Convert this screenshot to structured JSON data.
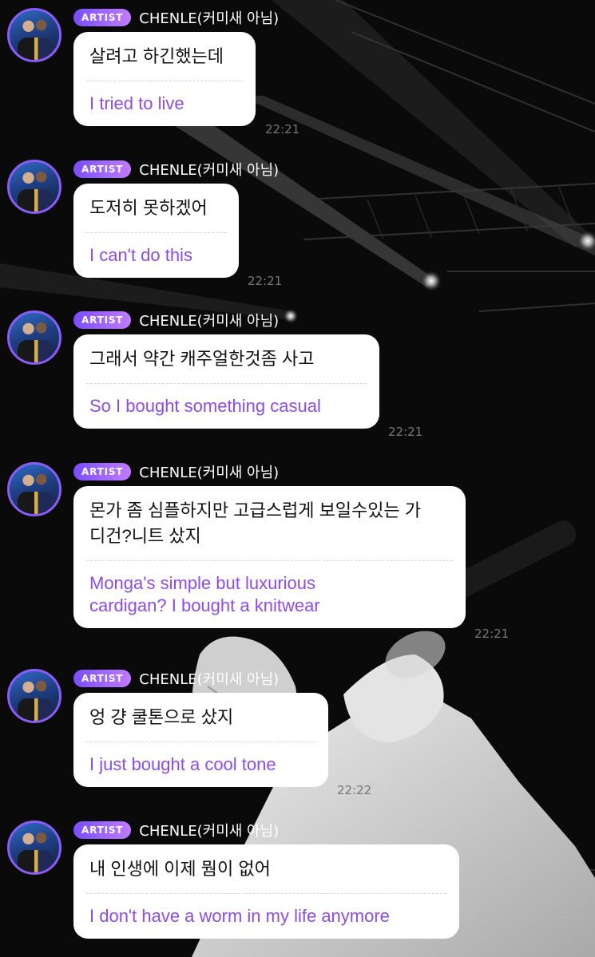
{
  "messages": [
    {
      "badge": "ARTIST",
      "name": "CHENLE(커미새 아님)",
      "original": "살려고 하긴했는데",
      "translation": "I tried to live",
      "time": "22:21"
    },
    {
      "badge": "ARTIST",
      "name": "CHENLE(커미새 아님)",
      "original": "도저히 못하겠어",
      "translation": "I can't do this",
      "time": "22:21"
    },
    {
      "badge": "ARTIST",
      "name": "CHENLE(커미새 아님)",
      "original": "그래서 약간 캐주얼한것좀 사고",
      "translation": "So I bought something casual",
      "time": "22:21"
    },
    {
      "badge": "ARTIST",
      "name": "CHENLE(커미새 아님)",
      "original": "몬가 좀 심플하지만 고급스럽게 보일수있는 가\n디건?니트 샀지",
      "translation": "Monga's simple but luxurious\ncardigan? I bought a knitwear",
      "time": "22:21"
    },
    {
      "badge": "ARTIST",
      "name": "CHENLE(커미새 아님)",
      "original": "엉 걍 쿨톤으로 샀지",
      "translation": "I just bought a cool tone",
      "time": "22:22"
    },
    {
      "badge": "ARTIST",
      "name": "CHENLE(커미새 아님)",
      "original": "내 인생에 이제 뭠이 없어",
      "translation": "I don't have a worm in my life anymore",
      "time": ""
    }
  ]
}
